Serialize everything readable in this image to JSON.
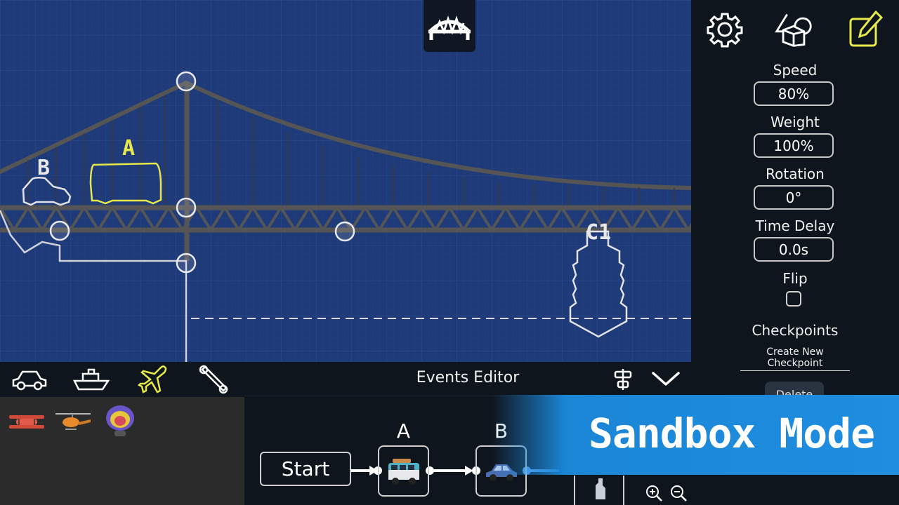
{
  "scene": {
    "vehicle_labels": [
      {
        "text": "A",
        "color": "#e7e94a"
      },
      {
        "text": "B",
        "color": "#e8e8e8"
      },
      {
        "text": "C1",
        "color": "#e8e8e8"
      }
    ],
    "colors": {
      "blueprint": "#1f3a78",
      "grid": "#2a4a8c",
      "steel": "#4a4a4a",
      "selection": "#e7e94a"
    }
  },
  "top_toolbar": {
    "icon": "bridge-icon"
  },
  "properties_panel": {
    "icons": [
      "gear-icon",
      "shapes-icon",
      "edit-icon"
    ],
    "speed_label": "Speed",
    "speed_value": "80%",
    "weight_label": "Weight",
    "weight_value": "100%",
    "rotation_label": "Rotation",
    "rotation_value": "0°",
    "time_delay_label": "Time Delay",
    "time_delay_value": "0.0s",
    "flip_label": "Flip",
    "flip_checked": false,
    "checkpoints_label": "Checkpoints",
    "create_checkpoint_label": "Create New Checkpoint",
    "delete_label": "Delete"
  },
  "vehicle_panel": {
    "tabs": [
      "car-icon",
      "boat-icon",
      "plane-icon",
      "tool-icon"
    ],
    "active_tab": "plane-icon",
    "items": [
      "biplane-icon",
      "helicopter-icon",
      "blimp-icon"
    ]
  },
  "events_editor": {
    "title": "Events Editor",
    "start_label": "Start",
    "events": [
      {
        "label": "A",
        "icon": "van-icon"
      },
      {
        "label": "B",
        "icon": "car-icon"
      }
    ],
    "zoom_in": "zoom-in-icon",
    "zoom_out": "zoom-out-icon"
  },
  "banner": {
    "text": "Sandbox Mode",
    "color": "#1f8de0"
  }
}
